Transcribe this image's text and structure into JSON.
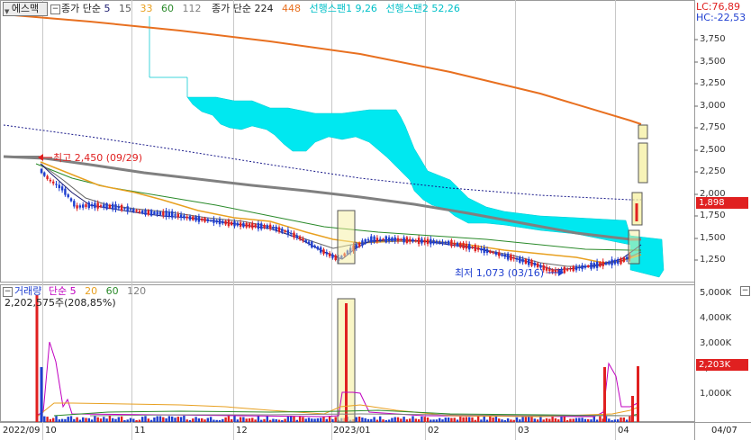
{
  "header": {
    "ticker": "에스맥",
    "ma_label": "종가 단순",
    "ma_periods": [
      "5",
      "15",
      "33",
      "60",
      "112"
    ],
    "ma2_label": "종가 단순",
    "ma2_periods": [
      "224",
      "448"
    ],
    "span1": "선행스팬1 9,26",
    "span2": "선행스팬2 52,26",
    "lc": "LC:76,89",
    "hc": "HC:-22,53"
  },
  "price_axis": {
    "labels": [
      "3,750",
      "3,500",
      "3,250",
      "3,000",
      "2,750",
      "2,500",
      "2,250",
      "2,000",
      "1,750",
      "1,500",
      "1,250"
    ],
    "current_price": "1,898"
  },
  "annotations": {
    "high": "최고 2,450 (09/29)",
    "low": "최저 1,073 (03/16)"
  },
  "volume_legend": {
    "label": "거래량",
    "ma_label": "단순",
    "periods": [
      "5",
      "20",
      "60",
      "120"
    ],
    "last_value": "2,202,575주(208,85%)"
  },
  "volume_axis": {
    "labels": [
      "5,000K",
      "4,000K",
      "3,000K",
      "2,000K",
      "1,000K"
    ],
    "current_volume": "2,203K"
  },
  "x_axis": {
    "labels": [
      "2022/09",
      "10",
      "11",
      "12",
      "2023/01",
      "02",
      "03",
      "04",
      "04/07"
    ]
  },
  "colors": {
    "up": "#e02020",
    "down": "#1f3fd0",
    "ma5": "#1a1a6e",
    "ma15": "#555555",
    "ma33": "#e8a020",
    "ma60": "#2a8a2a",
    "ma112": "#808080",
    "ma224": "#e87020",
    "ma448": "#1a1a8a",
    "cloud": "#00e8f0",
    "highlight": "#f5f0a0"
  },
  "chart_data": {
    "type": "candlestick",
    "y_range": [
      1100,
      3900
    ],
    "volume_range": [
      0,
      5200
    ],
    "high_label_value": 2450,
    "low_label_value": 1073,
    "current_price": 1898
  }
}
